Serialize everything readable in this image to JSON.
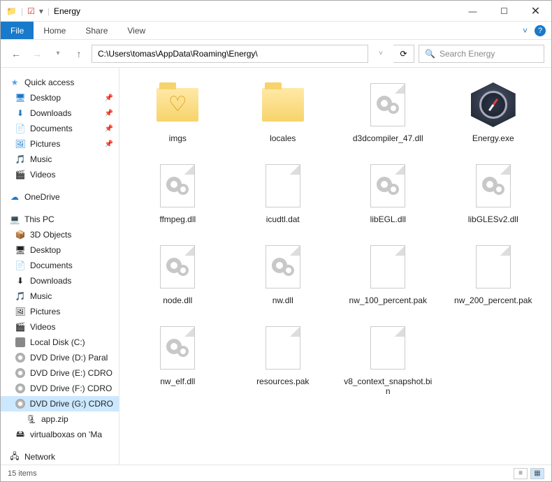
{
  "window": {
    "title": "Energy"
  },
  "ribbon": {
    "file": "File",
    "tabs": [
      "Home",
      "Share",
      "View"
    ]
  },
  "address": {
    "path": "C:\\Users\\tomas\\AppData\\Roaming\\Energy\\",
    "search_placeholder": "Search Energy"
  },
  "sidebar": {
    "quick_access": {
      "label": "Quick access"
    },
    "quick_items": [
      {
        "label": "Desktop",
        "pinned": true,
        "icon": "desktop"
      },
      {
        "label": "Downloads",
        "pinned": true,
        "icon": "downloads"
      },
      {
        "label": "Documents",
        "pinned": true,
        "icon": "documents"
      },
      {
        "label": "Pictures",
        "pinned": true,
        "icon": "pictures"
      },
      {
        "label": "Music",
        "pinned": false,
        "icon": "music"
      },
      {
        "label": "Videos",
        "pinned": false,
        "icon": "videos"
      }
    ],
    "onedrive": {
      "label": "OneDrive"
    },
    "this_pc": {
      "label": "This PC"
    },
    "pc_items": [
      {
        "label": "3D Objects",
        "icon": "3d"
      },
      {
        "label": "Desktop",
        "icon": "desktop"
      },
      {
        "label": "Documents",
        "icon": "documents"
      },
      {
        "label": "Downloads",
        "icon": "downloads"
      },
      {
        "label": "Music",
        "icon": "music"
      },
      {
        "label": "Pictures",
        "icon": "pictures"
      },
      {
        "label": "Videos",
        "icon": "videos"
      },
      {
        "label": "Local Disk (C:)",
        "icon": "disk"
      },
      {
        "label": "DVD Drive (D:) Paral",
        "icon": "dvd"
      },
      {
        "label": "DVD Drive (E:) CDRO",
        "icon": "dvd"
      },
      {
        "label": "DVD Drive (F:) CDRO",
        "icon": "dvd"
      },
      {
        "label": "DVD Drive (G:) CDRO",
        "icon": "dvd",
        "selected": true
      },
      {
        "label": "app.zip",
        "icon": "zip",
        "indent": true
      },
      {
        "label": "virtualboxas on 'Ma",
        "icon": "netdrive"
      }
    ],
    "network": {
      "label": "Network"
    }
  },
  "files": [
    {
      "name": "imgs",
      "type": "folder-heart"
    },
    {
      "name": "locales",
      "type": "folder"
    },
    {
      "name": "d3dcompiler_47.dll",
      "type": "dll"
    },
    {
      "name": "Energy.exe",
      "type": "exe"
    },
    {
      "name": "ffmpeg.dll",
      "type": "dll"
    },
    {
      "name": "icudtl.dat",
      "type": "file"
    },
    {
      "name": "libEGL.dll",
      "type": "dll"
    },
    {
      "name": "libGLESv2.dll",
      "type": "dll"
    },
    {
      "name": "node.dll",
      "type": "dll"
    },
    {
      "name": "nw.dll",
      "type": "dll"
    },
    {
      "name": "nw_100_percent.pak",
      "type": "file"
    },
    {
      "name": "nw_200_percent.pak",
      "type": "file"
    },
    {
      "name": "nw_elf.dll",
      "type": "dll"
    },
    {
      "name": "resources.pak",
      "type": "file"
    },
    {
      "name": "v8_context_snapshot.bin",
      "type": "file"
    }
  ],
  "status": {
    "count": "15 items"
  }
}
